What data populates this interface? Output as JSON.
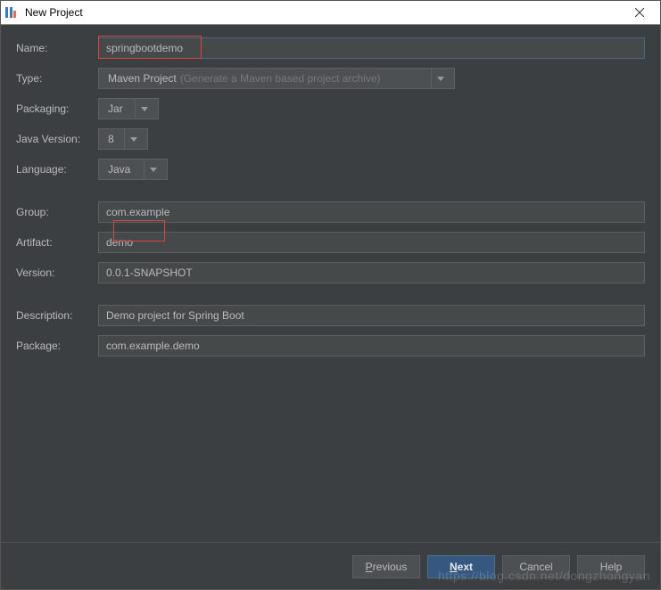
{
  "window": {
    "title": "New Project"
  },
  "fields": {
    "name": {
      "label": "Name:",
      "value": "springbootdemo"
    },
    "type": {
      "label": "Type:",
      "value": "Maven Project",
      "hint": "(Generate a Maven based project archive)"
    },
    "packaging": {
      "label": "Packaging:",
      "value": "Jar"
    },
    "javaVersion": {
      "label": "Java Version:",
      "value": "8"
    },
    "language": {
      "label": "Language:",
      "value": "Java"
    },
    "group": {
      "label": "Group:",
      "value": "com.example"
    },
    "artifact": {
      "label": "Artifact:",
      "value": "demo"
    },
    "version": {
      "label": "Version:",
      "value": "0.0.1-SNAPSHOT"
    },
    "description": {
      "label": "Description:",
      "value": "Demo project for Spring Boot"
    },
    "package": {
      "label": "Package:",
      "value": "com.example.demo"
    }
  },
  "buttons": {
    "previous": "Previous",
    "next": "Next",
    "cancel": "Cancel",
    "help": "Help"
  },
  "watermark": "https://blog.csdn.net/dongzhongyan"
}
